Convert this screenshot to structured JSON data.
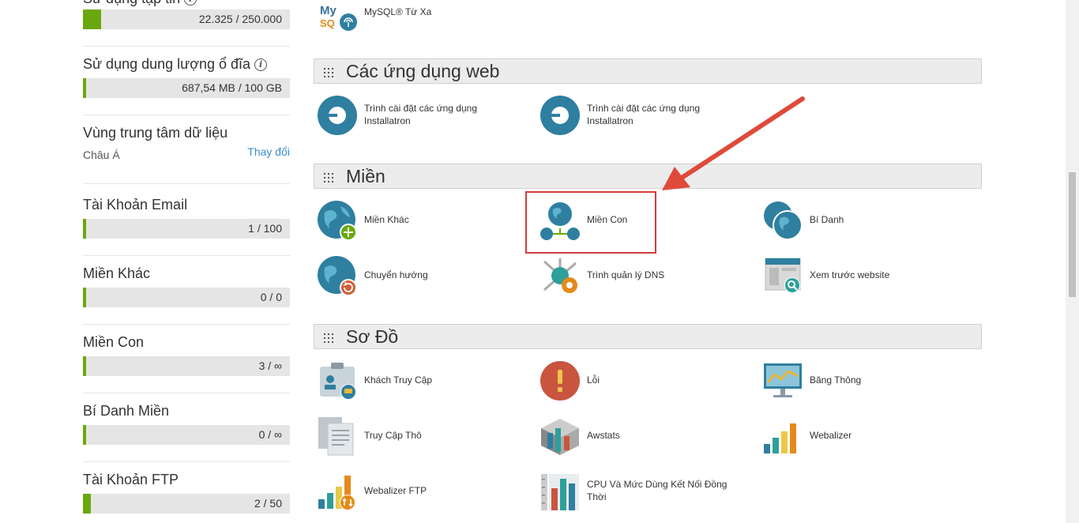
{
  "sidebar": {
    "stats": [
      {
        "title": "Sử dụng tập tin",
        "value_text": "22.325 / 250.000",
        "fraction": 0.0893
      },
      {
        "title": "Sử dụng dung lượng ổ đĩa",
        "value_text": "687,54 MB / 100 GB",
        "fraction": 0.0067
      },
      {
        "title": "Tài Khoản Email",
        "value_text": "1 / 100",
        "fraction": 0.01
      },
      {
        "title": "Miền Khác",
        "value_text": "0 / 0",
        "fraction": 0.0
      },
      {
        "title": "Miền Con",
        "value_text": "3 / ∞",
        "fraction": 0.0
      },
      {
        "title": "Bí Danh Miền",
        "value_text": "0 / ∞",
        "fraction": 0.0
      },
      {
        "title": "Tài Khoản FTP",
        "value_text": "2 / 50",
        "fraction": 0.04
      }
    ],
    "datacenter": {
      "title": "Vùng trung tâm dữ liệu",
      "value": "Châu Á",
      "change_link": "Thay đổi"
    }
  },
  "top_item": {
    "label": "MySQL® Từ Xa",
    "icon": "mysql-remote-icon"
  },
  "sections": {
    "web_apps": {
      "title": "Các ứng dụng web",
      "items": [
        {
          "label": "Trình cài đặt các ứng dụng Installatron",
          "icon": "installatron-icon"
        },
        {
          "label": "Trình cài đặt các ứng dụng Installatron",
          "icon": "installatron-icon"
        }
      ]
    },
    "domains": {
      "title": "Miền",
      "items": [
        {
          "label": "Miền Khác",
          "icon": "addon-domain-icon"
        },
        {
          "label": "Miền Con",
          "icon": "subdomain-icon"
        },
        {
          "label": "Bí Danh",
          "icon": "alias-icon"
        },
        {
          "label": "Chuyển hướng",
          "icon": "redirect-icon"
        },
        {
          "label": "Trình quản lý DNS",
          "icon": "dns-manager-icon"
        },
        {
          "label": "Xem trước website",
          "icon": "website-preview-icon"
        }
      ]
    },
    "metrics": {
      "title": "Sơ Đồ",
      "items": [
        {
          "label": "Khách Truy Cập",
          "icon": "visitors-icon"
        },
        {
          "label": "Lỗi",
          "icon": "errors-icon"
        },
        {
          "label": "Băng Thông",
          "icon": "bandwidth-icon"
        },
        {
          "label": "Truy Cập Thô",
          "icon": "raw-access-icon"
        },
        {
          "label": "Awstats",
          "icon": "awstats-icon"
        },
        {
          "label": "Webalizer",
          "icon": "webalizer-icon"
        },
        {
          "label": "Webalizer FTP",
          "icon": "webalizer-ftp-icon"
        },
        {
          "label": "CPU Và Mức Dùng Kết Nối Đồng Thời",
          "icon": "cpu-usage-icon"
        }
      ]
    }
  },
  "colors": {
    "accent_green": "#6aa80f",
    "link_blue": "#3a8fd0",
    "highlight_red": "#d63b3b",
    "icon_teal": "#2f7fa0"
  }
}
